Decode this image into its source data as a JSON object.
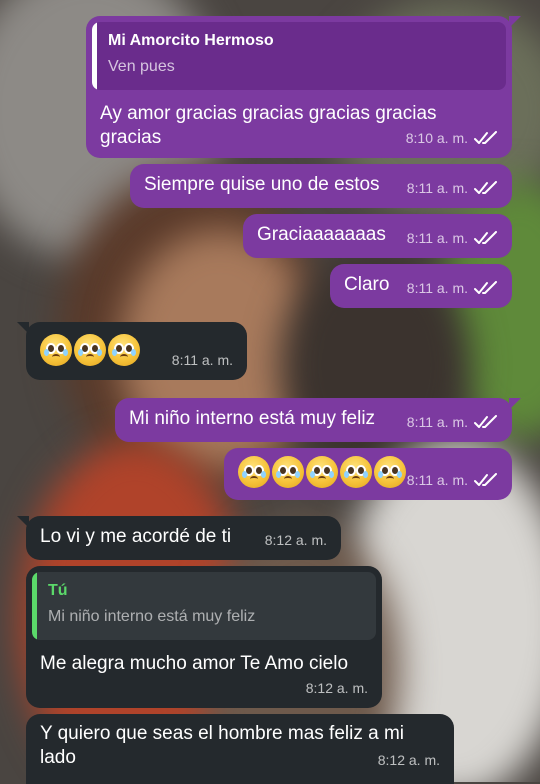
{
  "colors": {
    "outgoing_bubble": "#7c3aa0",
    "incoming_bubble": "#24292d",
    "reply_purple_name": "#ffffff",
    "reply_green_name": "#5bd96a"
  },
  "messages": [
    {
      "direction": "out",
      "reply": {
        "name": "Mi Amorcito Hermoso",
        "text": "Ven pues"
      },
      "text": "Ay amor gracias gracias gracias gracias gracias",
      "time": "8:10 a. m.",
      "status_icon": "double-check-icon"
    },
    {
      "direction": "out",
      "text": "Siempre quise uno de estos",
      "time": "8:11 a. m.",
      "status_icon": "double-check-icon"
    },
    {
      "direction": "out",
      "text": "Graciaaaaaaas",
      "time": "8:11 a. m.",
      "status_icon": "double-check-icon"
    },
    {
      "direction": "out",
      "text": "Claro",
      "time": "8:11 a. m.",
      "status_icon": "double-check-icon"
    },
    {
      "direction": "in",
      "emoji": [
        "pleading-face",
        "pleading-face",
        "pleading-face"
      ],
      "time": "8:11 a. m."
    },
    {
      "direction": "out",
      "text": "Mi niño interno está muy feliz",
      "time": "8:11 a. m.",
      "status_icon": "double-check-icon"
    },
    {
      "direction": "out",
      "emoji": [
        "pleading-face",
        "pleading-face",
        "pleading-face",
        "pleading-face",
        "pleading-face"
      ],
      "time": "8:11 a. m.",
      "status_icon": "double-check-icon"
    },
    {
      "direction": "in",
      "text": "Lo vi y me acordé de ti",
      "time": "8:12 a. m."
    },
    {
      "direction": "in",
      "reply": {
        "name": "Tú",
        "text": "Mi niño interno está muy feliz"
      },
      "text": "Me alegra mucho amor Te Amo cielo",
      "time": "8:12 a. m."
    },
    {
      "direction": "in",
      "text": "Y quiero que seas el hombre mas feliz a mi lado",
      "time": "8:12 a. m."
    }
  ]
}
